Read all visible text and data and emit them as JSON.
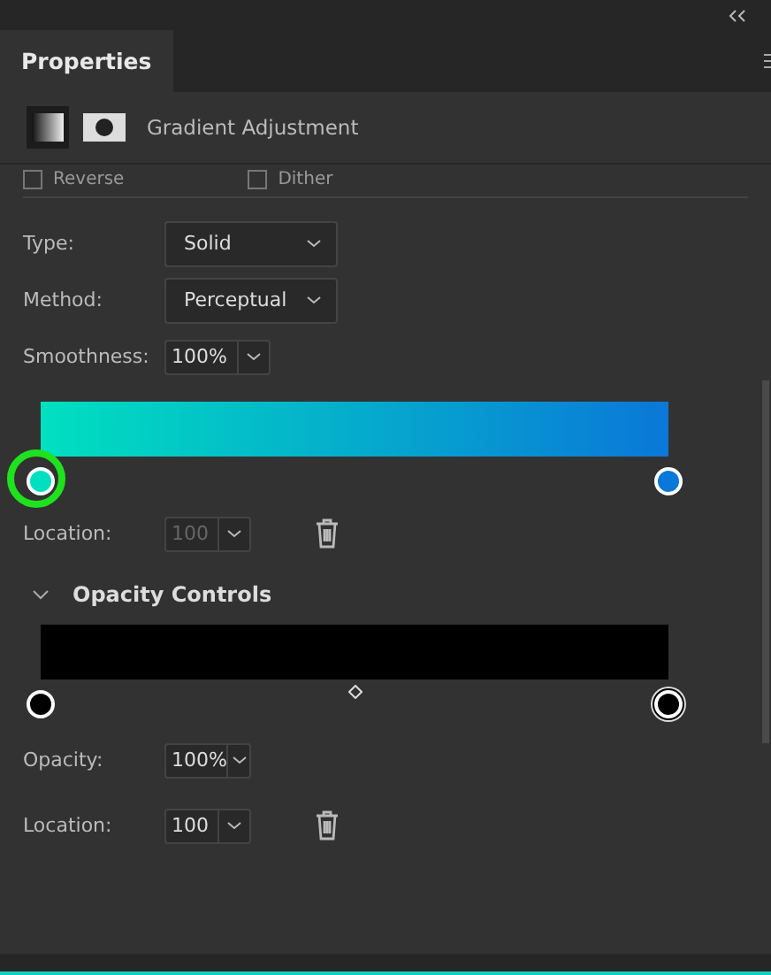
{
  "panel": {
    "tab": {
      "label": "Properties",
      "selected": true
    },
    "title": "Gradient Adjustment"
  },
  "options": [
    {
      "label": "Reverse",
      "checked": false
    },
    {
      "label": "Dither",
      "checked": false
    }
  ],
  "fields": [
    {
      "kind": "select",
      "label": "Type:",
      "value": "Solid"
    },
    {
      "kind": "select",
      "label": "Method:",
      "value": "Perceptual"
    },
    {
      "kind": "combo",
      "label": "Smoothness:",
      "value": "100%"
    }
  ],
  "color_stops": [
    {
      "color": "#00e0c0",
      "selected": true
    },
    {
      "color": "#0a78d8",
      "selected": false
    }
  ],
  "color_location": {
    "label": "Location:",
    "value": "100",
    "disabled": true
  },
  "opacity_section": {
    "title": "Opacity Controls",
    "expanded": true,
    "stops": [
      {
        "selected": false
      },
      {
        "selected": true
      }
    ],
    "fields": [
      {
        "label": "Opacity:",
        "value": "100%",
        "disabled": false,
        "trash": false
      },
      {
        "label": "Location:",
        "value": "100",
        "disabled": false,
        "trash": true
      }
    ]
  }
}
